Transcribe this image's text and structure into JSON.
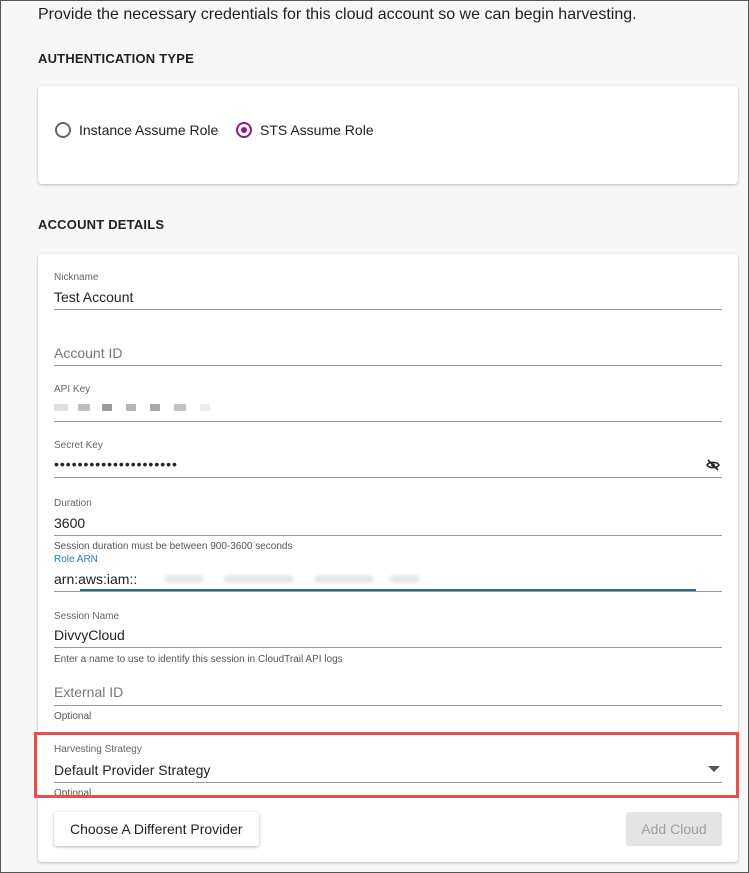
{
  "intro_text": "Provide the necessary credentials for this cloud account so we can begin harvesting.",
  "auth_section": {
    "title": "AUTHENTICATION TYPE",
    "options": [
      {
        "label": "Instance Assume Role",
        "selected": false
      },
      {
        "label": "STS Assume Role",
        "selected": true
      }
    ]
  },
  "account_section": {
    "title": "ACCOUNT DETAILS",
    "nickname": {
      "label": "Nickname",
      "value": "Test Account"
    },
    "account_id": {
      "placeholder": "Account ID"
    },
    "api_key": {
      "label": "API Key"
    },
    "secret_key": {
      "label": "Secret Key",
      "value": "•••••••••••••••••••••",
      "icon": "eye-off-icon"
    },
    "duration": {
      "label": "Duration",
      "value": "3600",
      "helper": "Session duration must be between 900-3600 seconds"
    },
    "role_arn": {
      "label": "Role ARN",
      "value": "arn:aws:iam::"
    },
    "session_name": {
      "label": "Session Name",
      "value": "DivvyCloud",
      "helper": "Enter a name to use to identify this session in CloudTrail API logs"
    },
    "external_id": {
      "placeholder": "External ID",
      "helper": "Optional"
    },
    "harvesting_strategy": {
      "label": "Harvesting Strategy",
      "value": "Default Provider Strategy",
      "helper": "Optional",
      "icon": "chevron-down-icon"
    }
  },
  "actions": {
    "choose_provider": "Choose A Different Provider",
    "add_cloud": "Add Cloud"
  },
  "colors": {
    "accent": "#8a1f7a",
    "focus_underline": "#1f7fbf",
    "highlight": "#e8504a"
  }
}
